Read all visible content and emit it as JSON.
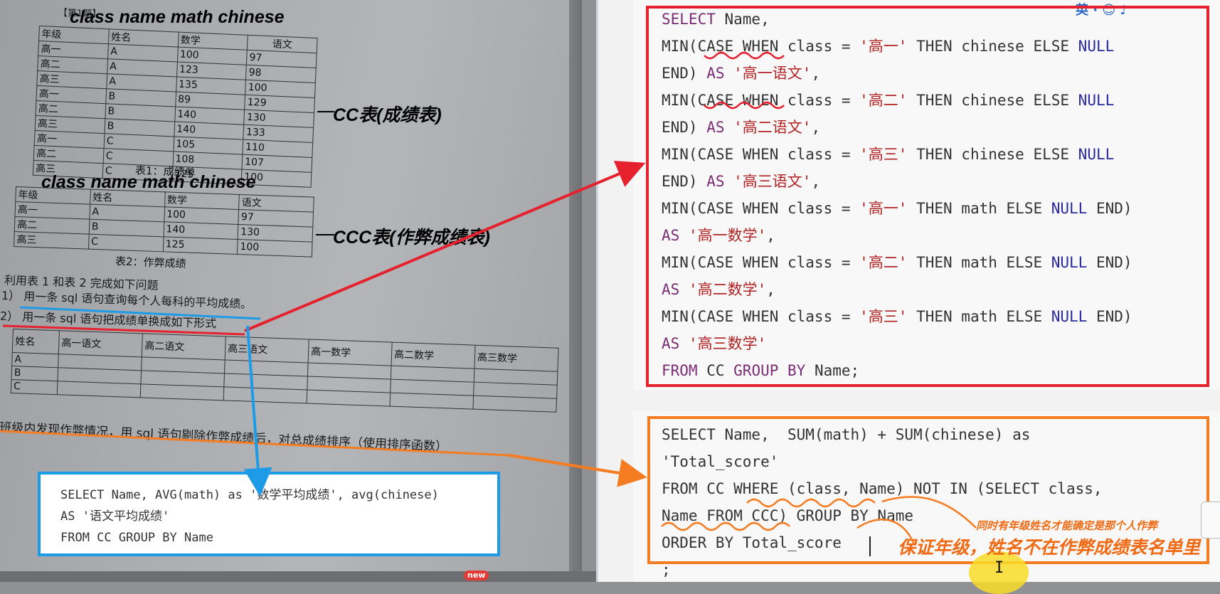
{
  "worksheet": {
    "heading": "【第1题】",
    "ann_cols_1": "class  name  math  chinese",
    "ann_cc": "CC表(成绩表)",
    "ann_cols_2": "class  name  math  chinese",
    "ann_ccc": "CCC表(作弊成绩表)",
    "table1": {
      "headers": [
        "年级",
        "姓名",
        "数学",
        "语文"
      ],
      "rows": [
        [
          "高一",
          "A",
          "100",
          "97"
        ],
        [
          "高二",
          "A",
          "123",
          "98"
        ],
        [
          "高三",
          "A",
          "135",
          "100"
        ],
        [
          "高一",
          "B",
          "89",
          "129"
        ],
        [
          "高二",
          "B",
          "140",
          "130"
        ],
        [
          "高三",
          "B",
          "140",
          "133"
        ],
        [
          "高一",
          "C",
          "105",
          "110"
        ],
        [
          "高二",
          "C",
          "108",
          "107"
        ],
        [
          "高三",
          "C",
          "125",
          "100"
        ]
      ],
      "caption": "表1：成绩单"
    },
    "table2": {
      "headers": [
        "年级",
        "姓名",
        "数学",
        "语文"
      ],
      "rows": [
        [
          "高一",
          "A",
          "100",
          "97"
        ],
        [
          "高二",
          "B",
          "140",
          "130"
        ],
        [
          "高三",
          "C",
          "125",
          "100"
        ]
      ],
      "caption": "表2：作弊成绩"
    },
    "intro": "利用表 1 和表 2 完成如下问题",
    "q1": "1）  用一条 sql 语句查询每个人每科的平均成绩。",
    "q2": "2）  用一条 sql 语句把成绩单换成如下形式",
    "table3": {
      "headers": [
        "姓名",
        "高一语文",
        "高二语文",
        "高三语文",
        "高一数学",
        "高二数学",
        "高三数学"
      ],
      "rows": [
        "A",
        "B",
        "C"
      ]
    },
    "q3": "班级内发现作弊情况，用 sql 语句剔除作弊成绩后，对总成绩排序（使用排序函数）"
  },
  "blue_code": {
    "line1": "SELECT Name, AVG(math) as '数学平均成绩', avg(chinese)",
    "line2": "AS '语文平均成绩'",
    "line3": "FROM CC GROUP BY Name"
  },
  "ui": {
    "new_badge": "new",
    "ime_text": "英 · ☺ ♪"
  },
  "red_code": {
    "l1": {
      "kw": "SELECT",
      "rest": " Name,"
    },
    "l2": {
      "a": "MIN(CASE WHEN class = ",
      "s": "'高一'",
      "b": " THEN chinese ELSE ",
      "n": "NULL"
    },
    "l3": {
      "a": "END) ",
      "kw": "AS",
      "s": " '高一语文'",
      "b": ","
    },
    "l4": {
      "a": "MIN(CASE WHEN class = ",
      "s": "'高二'",
      "b": " THEN chinese ELSE ",
      "n": "NULL"
    },
    "l5": {
      "a": "END) ",
      "kw": "AS",
      "s": " '高二语文'",
      "b": ","
    },
    "l6": {
      "a": "MIN(CASE WHEN class = ",
      "s": "'高三'",
      "b": " THEN chinese ELSE ",
      "n": "NULL"
    },
    "l7": {
      "a": "END) ",
      "kw": "AS",
      "s": " '高三语文'",
      "b": ","
    },
    "l8": {
      "a": "MIN(CASE WHEN class = ",
      "s": "'高一'",
      "b": " THEN math ELSE ",
      "n": "NULL",
      "c": " END)"
    },
    "l9": {
      "kw": "AS",
      "s": " '高一数学'",
      "b": ","
    },
    "l10": {
      "a": "MIN(CASE WHEN class = ",
      "s": "'高二'",
      "b": " THEN math ELSE ",
      "n": "NULL",
      "c": " END)"
    },
    "l11": {
      "kw": "AS",
      "s": " '高二数学'",
      "b": ","
    },
    "l12": {
      "a": "MIN(CASE WHEN class = ",
      "s": "'高三'",
      "b": " THEN math ELSE ",
      "n": "NULL",
      "c": " END)"
    },
    "l13": {
      "kw": "AS",
      "s": " '高三数学'"
    },
    "l14": {
      "kw1": "FROM",
      "mid": " CC ",
      "kw2": "GROUP BY",
      "end": " Name;"
    }
  },
  "orange_code": {
    "l1": "SELECT Name,  SUM(math) + SUM(chinese) as",
    "l2": "'Total_score'",
    "l3": "FROM CC WHERE (class, Name) NOT IN (SELECT class,",
    "l4": "Name FROM CCC) GROUP BY Name",
    "l5": "ORDER BY Total_score",
    "l6": ";"
  },
  "handwriting": {
    "note_small": "同时有年级姓名才能确定是那个人作弊",
    "note_big": "保证年级，姓名不在作弊成绩表名单里"
  },
  "colors": {
    "red_box": "#e6212e",
    "orange_box": "#f57c21",
    "blue_box": "#1e9be6",
    "keyword": "#7a2d74",
    "string": "#b22222",
    "null": "#2a2aa0"
  }
}
